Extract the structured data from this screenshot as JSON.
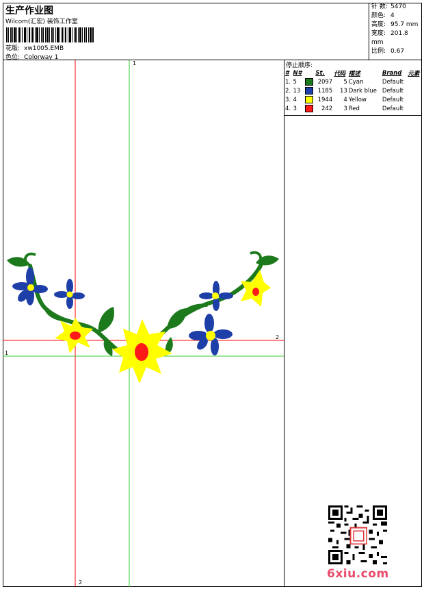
{
  "header": {
    "title": "生产作业图",
    "company": "Wilcom(汇宏) 装饰工作室",
    "design_label": "花版:",
    "design_name": "xw1005.EMB",
    "colorway_label": "色位:",
    "colorway_name": "Colorway 1"
  },
  "stats": [
    {
      "label": "针 数:",
      "value": "5470"
    },
    {
      "label": "颜色:",
      "value": "4"
    },
    {
      "label": "高度:",
      "value": "95.7 mm"
    },
    {
      "label": "宽度:",
      "value": "201.8 mm"
    },
    {
      "label": "比例:",
      "value": "0.67"
    }
  ],
  "stop_sequence": {
    "title": "停止顺序:",
    "columns": [
      "#",
      "N#",
      "St.",
      "代码",
      "描述",
      "Brand",
      "元素"
    ],
    "rows": [
      {
        "idx": "1.",
        "n": "5",
        "color": "#1c7a1c",
        "st": "2097",
        "code": "5",
        "desc": "Cyan",
        "brand": "Default"
      },
      {
        "idx": "2.",
        "n": "13",
        "color": "#1f3fa8",
        "st": "1185",
        "code": "13",
        "desc": "Dark blue",
        "brand": "Default"
      },
      {
        "idx": "3.",
        "n": "4",
        "color": "#ffff00",
        "st": "1944",
        "code": "4",
        "desc": "Yellow",
        "brand": "Default"
      },
      {
        "idx": "4.",
        "n": "3",
        "color": "#ff1a1a",
        "st": "242",
        "code": "3",
        "desc": "Red",
        "brand": "Default"
      }
    ]
  },
  "axis_labels": {
    "green_top": "1",
    "green_left": "1",
    "red_right": "2",
    "red_bottom": "2"
  },
  "watermark": "6xiu.com",
  "colors": {
    "green": "#1c7a1c",
    "blue": "#1f3fa8",
    "yellow": "#ffff00",
    "red": "#ff1a1a",
    "guide_red": "#ff0000",
    "guide_green": "#33cc33"
  }
}
